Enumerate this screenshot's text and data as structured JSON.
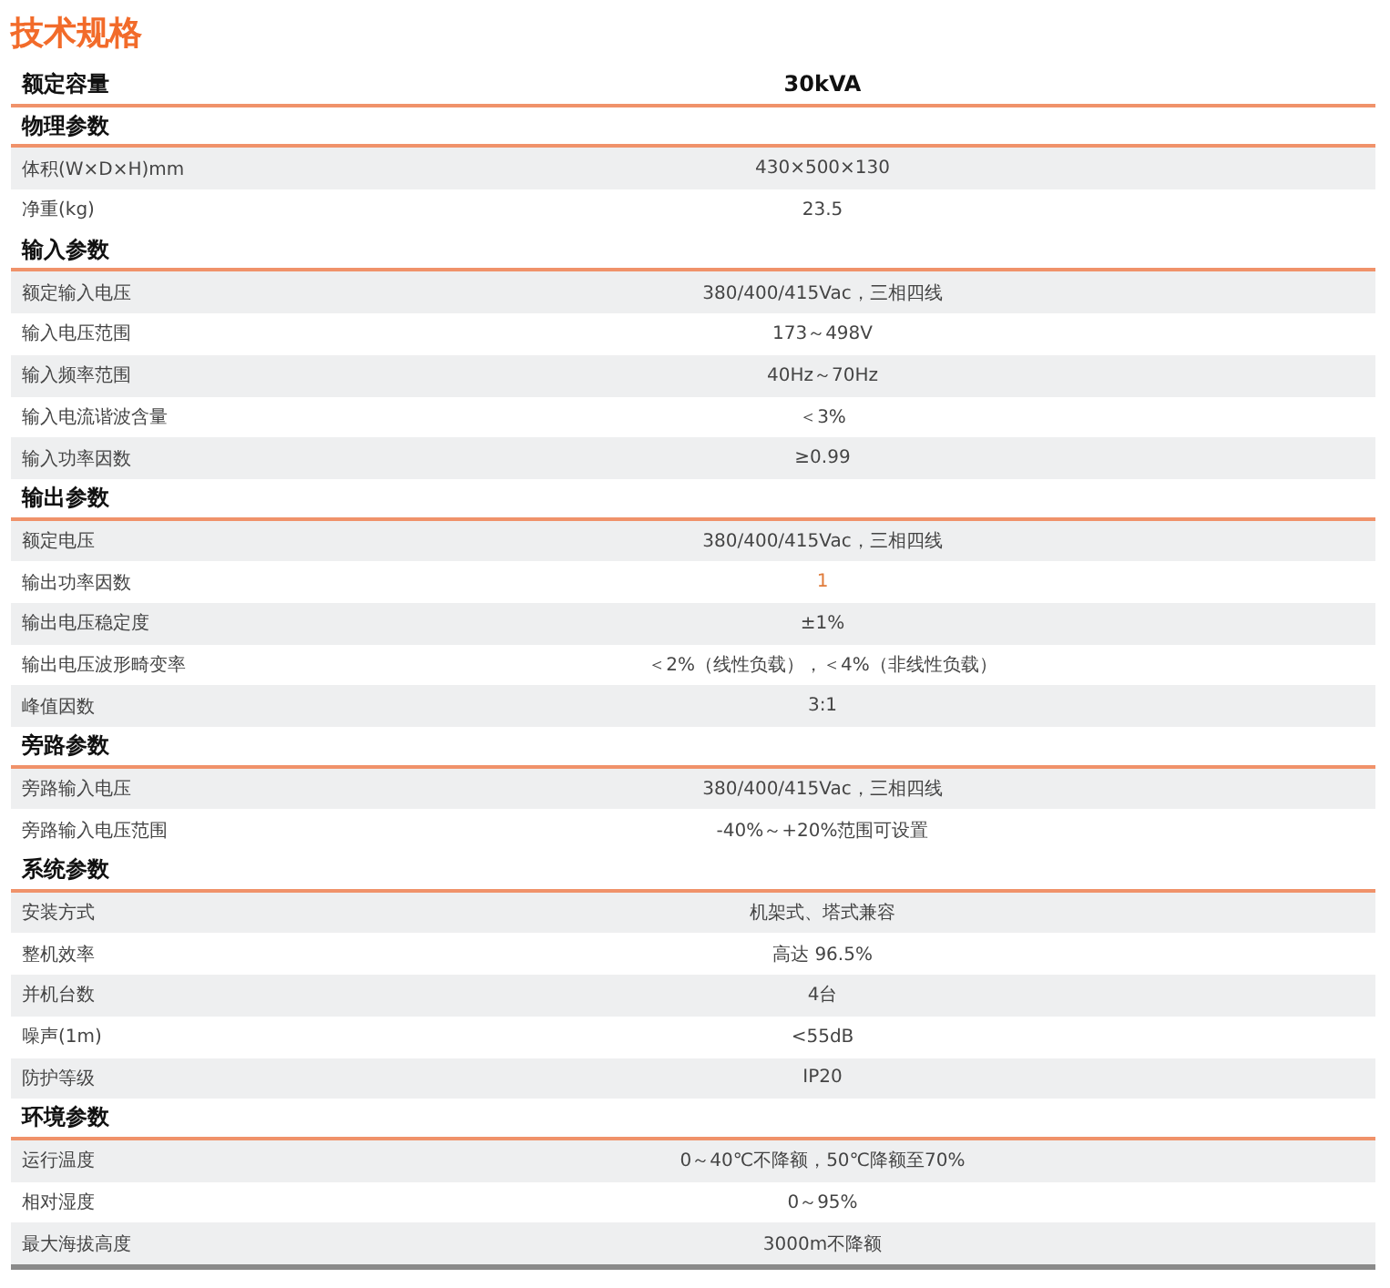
{
  "title": "技术规格",
  "header": {
    "label": "额定容量",
    "value": "30kVA"
  },
  "sections": [
    {
      "heading": "物理参数",
      "rows": [
        {
          "label": "体积(W×D×H)mm",
          "value": "430×500×130",
          "highlight": false
        },
        {
          "label": "净重(kg)",
          "value": "23.5",
          "highlight": false
        }
      ]
    },
    {
      "heading": "输入参数",
      "rows": [
        {
          "label": "额定输入电压",
          "value": "380/400/415Vac，三相四线",
          "highlight": false
        },
        {
          "label": "输入电压范围",
          "value": "173～498V",
          "highlight": false
        },
        {
          "label": "输入频率范围",
          "value": "40Hz～70Hz",
          "highlight": false
        },
        {
          "label": "输入电流谐波含量",
          "value": "＜3%",
          "highlight": false
        },
        {
          "label": "输入功率因数",
          "value": "≥0.99",
          "highlight": false
        }
      ]
    },
    {
      "heading": "输出参数",
      "rows": [
        {
          "label": "额定电压",
          "value": "380/400/415Vac，三相四线",
          "highlight": false
        },
        {
          "label": "输出功率因数",
          "value": "1",
          "highlight": true
        },
        {
          "label": "输出电压稳定度",
          "value": "±1%",
          "highlight": false
        },
        {
          "label": "输出电压波形畸变率",
          "value": "＜2%（线性负载），＜4%（非线性负载）",
          "highlight": false
        },
        {
          "label": "峰值因数",
          "value": "3:1",
          "highlight": false
        }
      ]
    },
    {
      "heading": "旁路参数",
      "rows": [
        {
          "label": "旁路输入电压",
          "value": "380/400/415Vac，三相四线",
          "highlight": false
        },
        {
          "label": "旁路输入电压范围",
          "value": "-40%～+20%范围可设置",
          "highlight": false
        }
      ]
    },
    {
      "heading": "系统参数",
      "rows": [
        {
          "label": "安装方式",
          "value": "机架式、塔式兼容",
          "highlight": false
        },
        {
          "label": "整机效率",
          "value": "高达 96.5%",
          "highlight": false
        },
        {
          "label": "并机台数",
          "value": "4台",
          "highlight": false
        },
        {
          "label": "噪声(1m)",
          "value": "<55dB",
          "highlight": false
        },
        {
          "label": "防护等级",
          "value": "IP20",
          "highlight": false
        }
      ]
    },
    {
      "heading": "环境参数",
      "rows": [
        {
          "label": "运行温度",
          "value": "0～40℃不降额，50℃降额至70%",
          "highlight": false
        },
        {
          "label": "相对湿度",
          "value": "0～95%",
          "highlight": false
        },
        {
          "label": "最大海拔高度",
          "value": "3000m不降额",
          "highlight": false
        }
      ]
    }
  ]
}
